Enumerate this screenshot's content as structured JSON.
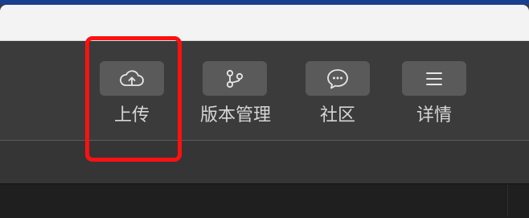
{
  "toolbar": {
    "buttons": [
      {
        "id": "upload",
        "label": "上传",
        "icon": "cloud-upload-icon"
      },
      {
        "id": "version",
        "label": "版本管理",
        "icon": "branch-icon"
      },
      {
        "id": "community",
        "label": "社区",
        "icon": "chat-bubble-icon"
      },
      {
        "id": "details",
        "label": "详情",
        "icon": "menu-icon"
      }
    ]
  },
  "colors": {
    "window_edge": "#1b3f8f",
    "toolbar_bg": "#3b3b3b",
    "button_bg": "#5a5a5a",
    "label": "#d6d6d6",
    "highlight": "#ff1111"
  }
}
